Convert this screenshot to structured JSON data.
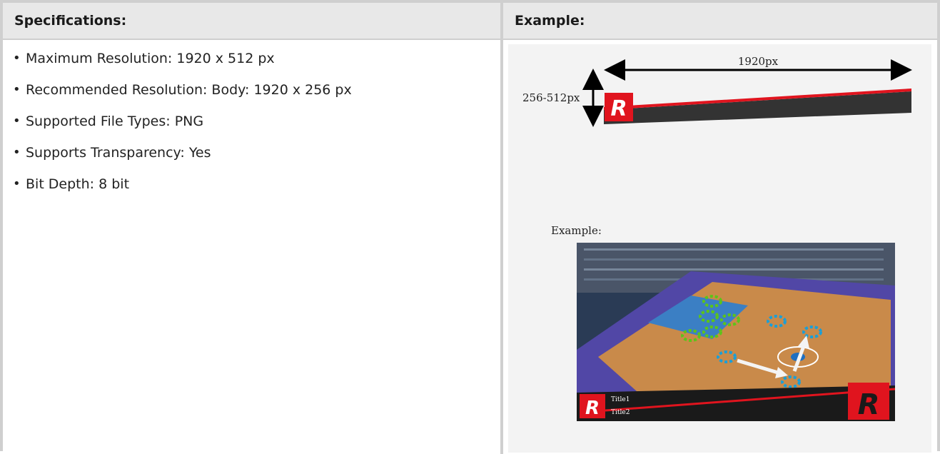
{
  "table": {
    "left_header": "Specifications:",
    "right_header": "Example:"
  },
  "specs": [
    "Maximum Resolution: 1920 x 512 px",
    "Recommended Resolution: Body: 1920 x 256 px",
    "Supported File Types: PNG",
    "Supports Transparency: Yes",
    "Bit Depth: 8 bit"
  ],
  "example": {
    "width_label": "1920px",
    "height_label": "256-512px",
    "example_caption": "Example:",
    "logo_letter": "R",
    "title1": "Title1",
    "title2": "Title2",
    "colors": {
      "accent_red": "#e0141e",
      "dark_bar": "#333333",
      "court_wood": "#c98a4a",
      "court_blue": "#3b7fc4",
      "apron_purple": "#5147a6"
    }
  }
}
